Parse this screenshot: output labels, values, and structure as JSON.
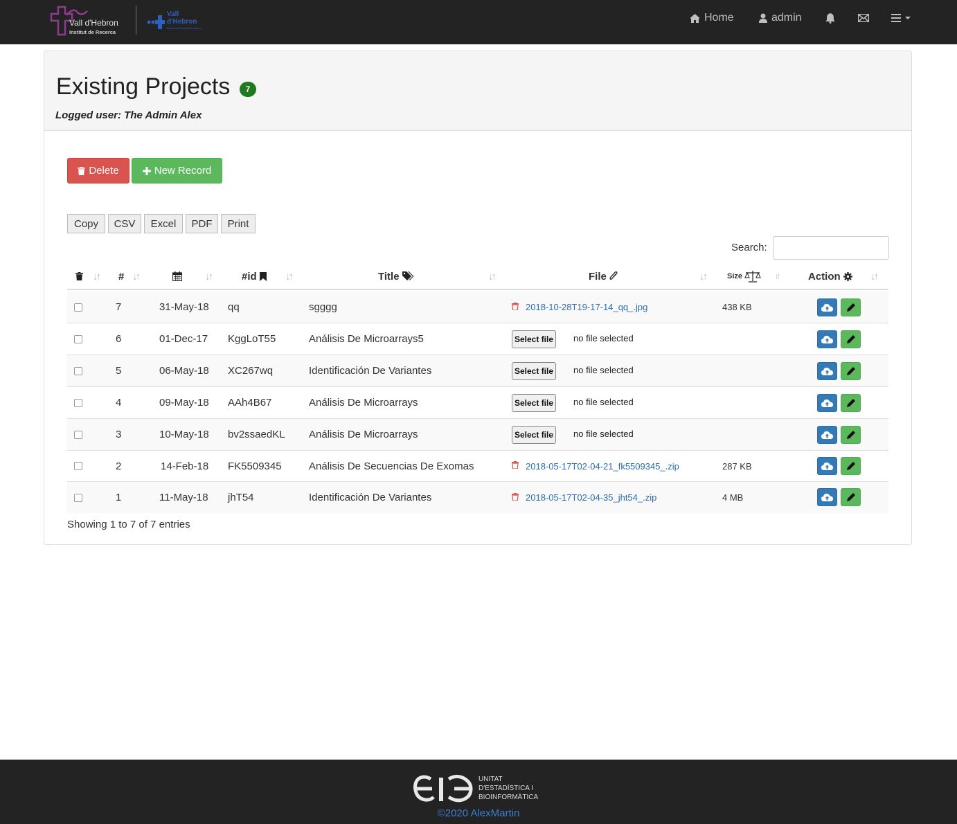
{
  "navbar": {
    "logo1": {
      "line1": "Vall d'Hebron",
      "line2": "Institut de Recerca"
    },
    "logo2": {
      "line1": "Vall",
      "line2": "d'Hebron",
      "line3": "Barcelona Hospital Campus"
    },
    "home_label": "Home",
    "user_label": "admin"
  },
  "header": {
    "title": "Existing Projects",
    "count": "7",
    "logged_user": "Logged user: The Admin Alex"
  },
  "actions": {
    "delete_label": "Delete",
    "new_record_label": "New Record"
  },
  "export_buttons": [
    "Copy",
    "CSV",
    "Excel",
    "PDF",
    "Print"
  ],
  "search": {
    "label": "Search:",
    "value": ""
  },
  "table": {
    "headers": {
      "num": "#",
      "id": "#id",
      "title": "Title",
      "file": "File",
      "size": "Size",
      "action": "Action"
    },
    "rows": [
      {
        "num": "7",
        "date": "31-May-18",
        "id": "qq",
        "title": "sgggg",
        "file": "2018-10-28T19-17-14_qq_.jpg",
        "size": "438 KB"
      },
      {
        "num": "6",
        "date": "01-Dec-17",
        "id": "KggLoT55",
        "title": "Análisis De Microarrays5",
        "select_label": "Select file",
        "no_file": "no file selected"
      },
      {
        "num": "5",
        "date": "06-May-18",
        "id": "XC267wq",
        "title": "Identificación De Variantes",
        "select_label": "Select file",
        "no_file": "no file selected"
      },
      {
        "num": "4",
        "date": "09-May-18",
        "id": "AAh4B67",
        "title": "Análisis De Microarrays",
        "select_label": "Select file",
        "no_file": "no file selected"
      },
      {
        "num": "3",
        "date": "10-May-18",
        "id": "bv2ssaedKL",
        "title": "Análisis De Microarrays",
        "select_label": "Select file",
        "no_file": "no file selected"
      },
      {
        "num": "2",
        "date": "14-Feb-18",
        "id": "FK5509345",
        "title": "Análisis De Secuencias De Exomas",
        "file": "2018-05-17T02-04-21_fk5509345_.zip",
        "size": "287 KB"
      },
      {
        "num": "1",
        "date": "11-May-18",
        "id": "jhT54",
        "title": "Identificación De Variantes",
        "file": "2018-05-17T02-04-35_jht54_.zip",
        "size": "4 MB"
      }
    ]
  },
  "showing": "Showing 1 to 7 of 7 entries",
  "footer": {
    "unit_line1": "UNITAT",
    "unit_line2": "D'ESTADÍSTICA I",
    "unit_line3": "BIOINFORMÀTICA",
    "copyright": "©2020 AlexMartin"
  },
  "colors": {
    "navbar": "#232323",
    "danger": "#d9534f",
    "success": "#5cb85c",
    "primary": "#337ab7",
    "badge": "#1f7a1f",
    "link": "#2a6db0"
  }
}
